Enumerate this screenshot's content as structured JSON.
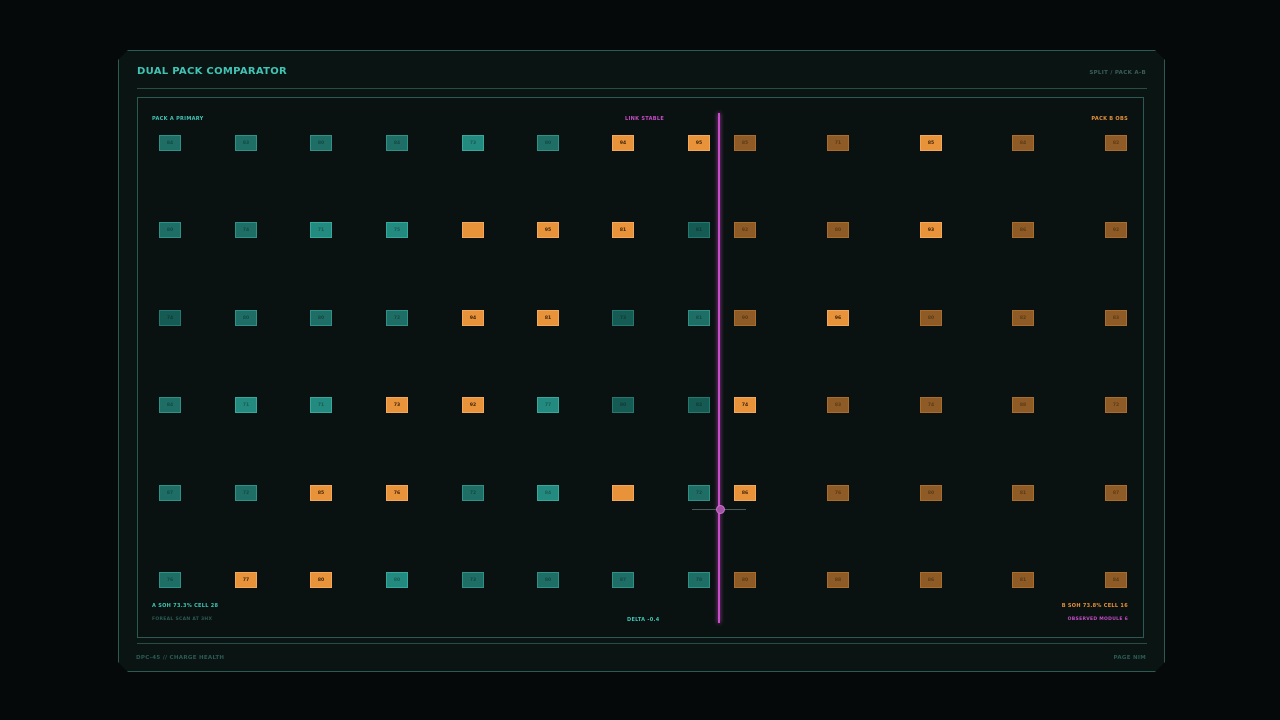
{
  "header": {
    "title": "DUAL PACK COMPARATOR",
    "mode": "SPLIT / PACK A-B"
  },
  "labels": {
    "pack_a": "PACK A PRIMARY",
    "link": "LINK STABLE",
    "pack_b": "PACK B OBS",
    "a_stats": "A SOH 73.3% CELL 28",
    "b_stats": "B SOH 73.8% CELL 16",
    "scan": "FOREAL SCAN AT 3HX",
    "delta": "DELTA -0.4",
    "observed": "OBSERVED MODULE 6"
  },
  "footer": {
    "left": "DPC-45 // CHARGE HEALTH",
    "right": "PAGE NIM"
  },
  "colors": {
    "teal": "#1f6e66",
    "orange": "#e8923a",
    "brown": "#8e5b26",
    "magenta": "#c94cc8",
    "accent": "#41c4b4"
  },
  "pack_a": {
    "rows": [
      [
        {
          "v": "84",
          "t": "teal"
        },
        {
          "v": "83",
          "t": "teal"
        },
        {
          "v": "80",
          "t": "teal"
        },
        {
          "v": "84",
          "t": "teal"
        },
        {
          "v": "73",
          "t": "tealL"
        },
        {
          "v": "80",
          "t": "teal"
        },
        {
          "v": "94",
          "t": "orange"
        },
        {
          "v": "95",
          "t": "orange"
        }
      ],
      [
        {
          "v": "80",
          "t": "teal"
        },
        {
          "v": "74",
          "t": "teal"
        },
        {
          "v": "71",
          "t": "tealL"
        },
        {
          "v": "75",
          "t": "tealL"
        },
        {
          "v": "",
          "t": "orange"
        },
        {
          "v": "95",
          "t": "orange"
        },
        {
          "v": "81",
          "t": "orange"
        },
        {
          "v": "81",
          "t": "dteal"
        }
      ],
      [
        {
          "v": "74",
          "t": "dteal"
        },
        {
          "v": "80",
          "t": "teal"
        },
        {
          "v": "80",
          "t": "teal"
        },
        {
          "v": "72",
          "t": "teal"
        },
        {
          "v": "94",
          "t": "orange"
        },
        {
          "v": "81",
          "t": "orange"
        },
        {
          "v": "73",
          "t": "dteal"
        },
        {
          "v": "81",
          "t": "teal"
        }
      ],
      [
        {
          "v": "84",
          "t": "teal"
        },
        {
          "v": "71",
          "t": "tealL"
        },
        {
          "v": "71",
          "t": "tealL"
        },
        {
          "v": "73",
          "t": "orange"
        },
        {
          "v": "92",
          "t": "orange"
        },
        {
          "v": "77",
          "t": "tealL"
        },
        {
          "v": "80",
          "t": "dteal"
        },
        {
          "v": "82",
          "t": "dteal"
        }
      ],
      [
        {
          "v": "87",
          "t": "teal"
        },
        {
          "v": "72",
          "t": "teal"
        },
        {
          "v": "85",
          "t": "orange"
        },
        {
          "v": "76",
          "t": "orange"
        },
        {
          "v": "72",
          "t": "teal"
        },
        {
          "v": "84",
          "t": "tealL"
        },
        {
          "v": "",
          "t": "orange"
        },
        {
          "v": "72",
          "t": "teal"
        }
      ],
      [
        {
          "v": "76",
          "t": "teal"
        },
        {
          "v": "77",
          "t": "orange"
        },
        {
          "v": "80",
          "t": "orange"
        },
        {
          "v": "80",
          "t": "tealL"
        },
        {
          "v": "73",
          "t": "teal"
        },
        {
          "v": "80",
          "t": "teal"
        },
        {
          "v": "87",
          "t": "teal"
        },
        {
          "v": "78",
          "t": "teal"
        }
      ]
    ]
  },
  "pack_b": {
    "rows": [
      [
        {
          "v": "85",
          "t": "brown"
        },
        {
          "v": "71",
          "t": "brown"
        },
        {
          "v": "85",
          "t": "orange"
        },
        {
          "v": "84",
          "t": "brown"
        },
        {
          "v": "82",
          "t": "brown"
        }
      ],
      [
        {
          "v": "92",
          "t": "brown"
        },
        {
          "v": "80",
          "t": "brown"
        },
        {
          "v": "93",
          "t": "orange"
        },
        {
          "v": "86",
          "t": "brown"
        },
        {
          "v": "92",
          "t": "brown"
        }
      ],
      [
        {
          "v": "90",
          "t": "brown"
        },
        {
          "v": "96",
          "t": "orange"
        },
        {
          "v": "80",
          "t": "brown"
        },
        {
          "v": "82",
          "t": "brown"
        },
        {
          "v": "83",
          "t": "brown"
        }
      ],
      [
        {
          "v": "74",
          "t": "orange"
        },
        {
          "v": "83",
          "t": "brown"
        },
        {
          "v": "74",
          "t": "brown"
        },
        {
          "v": "88",
          "t": "brown"
        },
        {
          "v": "72",
          "t": "brown"
        }
      ],
      [
        {
          "v": "86",
          "t": "orange"
        },
        {
          "v": "76",
          "t": "brown"
        },
        {
          "v": "80",
          "t": "brown"
        },
        {
          "v": "81",
          "t": "brown"
        },
        {
          "v": "87",
          "t": "brown"
        }
      ],
      [
        {
          "v": "80",
          "t": "brown"
        },
        {
          "v": "88",
          "t": "brown"
        },
        {
          "v": "86",
          "t": "brown"
        },
        {
          "v": "81",
          "t": "brown"
        },
        {
          "v": "84",
          "t": "brown"
        }
      ]
    ]
  }
}
